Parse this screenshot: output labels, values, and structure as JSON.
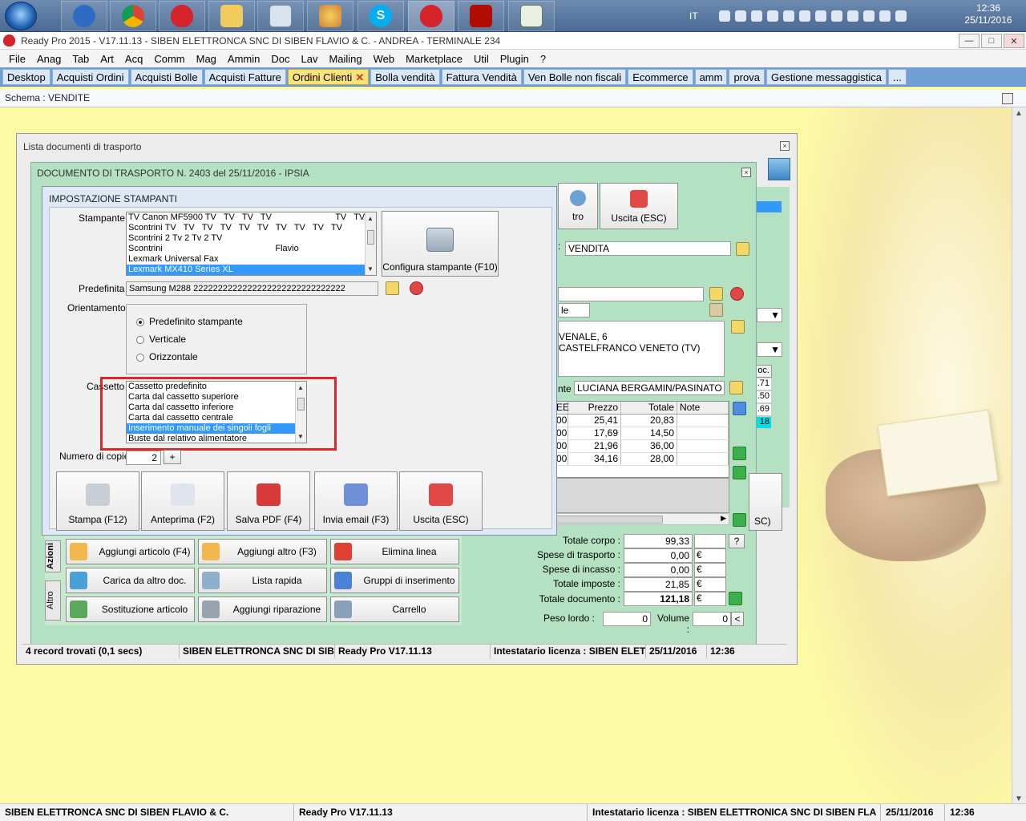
{
  "taskbar": {
    "language": "IT",
    "clock_time": "12:36",
    "clock_date": "25/11/2016"
  },
  "window": {
    "title": "Ready Pro 2015 - V17.11.13 - SIBEN ELETTRONCA SNC DI SIBEN FLAVIO & C. - ANDREA - TERMINALE 234",
    "min_label": "—",
    "max_label": "□",
    "close_label": "✕"
  },
  "menu": {
    "items": [
      "File",
      "Anag",
      "Tab",
      "Art",
      "Acq",
      "Comm",
      "Mag",
      "Ammin",
      "Doc",
      "Lav",
      "Mailing",
      "Web",
      "Marketplace",
      "Util",
      "Plugin",
      "?"
    ]
  },
  "tabs": {
    "items": [
      "Desktop",
      "Acquisti Ordini",
      "Acquisti Bolle",
      "Acquisti Fatture",
      "Ordini Clienti",
      "Bolla vendità",
      "Fattura Vendità",
      "Ven Bolle non fiscali",
      "Ecommerce",
      "amm",
      "prova",
      "Gestione messaggistica",
      "..."
    ],
    "active_index": 4,
    "close_glyph": "✕"
  },
  "schema": {
    "label": "Schema : VENDITE"
  },
  "lista": {
    "title": "Lista documenti di trasporto",
    "status_records": "4 record trovati (0,1 secs)",
    "status_company": "SIBEN ELETTRONCA SNC DI SIBEN F",
    "status_version": "Ready Pro V17.11.13",
    "status_license": "Intestatario licenza : SIBEN ELETT",
    "status_date": "25/11/2016",
    "status_time": "12:36",
    "side_values": [
      ".71",
      ".50",
      ".69",
      "18"
    ],
    "side_header": "oc."
  },
  "documento": {
    "title": "DOCUMENTO DI TRASPORTO N. 2403 del 25/11/2016 - IPSIA",
    "partial_btn_label": "tro",
    "exit_label": "Uscita (ESC)",
    "causale_value": "VENDITA",
    "field_le": "le",
    "address_line1": "VENALE, 6",
    "address_line2": "CASTELFRANCO VENETO  (TV)",
    "field_nte": "nte",
    "contact_value": "LUCIANA BERGAMIN/PASINATO",
    "table_headers": [
      "EE",
      "Prezzo",
      "Totale",
      "Note"
    ],
    "table_rows": [
      {
        "q": "00",
        "prezzo": "25,41",
        "totale": "20,83"
      },
      {
        "q": "00",
        "prezzo": "17,69",
        "totale": "14,50"
      },
      {
        "q": "00",
        "prezzo": "21,96",
        "totale": "36,00"
      },
      {
        "q": "00",
        "prezzo": "34,16",
        "totale": "28,00"
      }
    ],
    "totals": {
      "corpo_label": "Totale corpo :",
      "corpo_value": "99,33",
      "trasporto_label": "Spese di trasporto :",
      "trasporto_value": "0,00",
      "incasso_label": "Spese di incasso :",
      "incasso_value": "0,00",
      "imposte_label": "Totale imposte :",
      "imposte_value": "21,85",
      "documento_label": "Totale documento :",
      "documento_value": "121,18",
      "currency": "€",
      "help": "?"
    },
    "peso_label": "Peso lordo :",
    "peso_value": "0",
    "volume_label": "Volume :",
    "volume_value": "0",
    "lt": "<",
    "partial_sc": "SC)",
    "side_tabs": [
      "Azioni",
      "Altro"
    ],
    "actions": [
      "Aggiungi articolo (F4)",
      "Aggiungi altro (F3)",
      "Elimina linea",
      "Carica da altro doc.",
      "Lista rapida",
      "Gruppi di inserimento",
      "Sostituzione articolo",
      "Aggiungi riparazione",
      "Carrello"
    ]
  },
  "dialog": {
    "title": "IMPOSTAZIONE STAMPANTI",
    "printers_label": "Stampante",
    "printers": [
      "TV Canon MF5900 TV   TV   TV   TV                          TV   TV   TV   TV",
      "Scontrini TV   TV   TV   TV   TV   TV   TV   TV   TV   TV",
      "Scontrini 2 Tv 2 Tv 2 TV",
      "Scontrini                                              Flavio",
      "Lexmark Universal Fax",
      "Lexmark MX410 Series XL"
    ],
    "printer_selected": 5,
    "config_btn": "Configura stampante (F10)",
    "default_label": "Predefinita",
    "default_value": "Samsung M288 2222222222222222222222222222222",
    "orient_label": "Orientamento",
    "orient_options": [
      "Predefinito stampante",
      "Verticale",
      "Orizzontale"
    ],
    "orient_selected": 0,
    "tray_label": "Cassetto",
    "trays": [
      "Cassetto predefinito",
      "Carta dal cassetto superiore",
      "Carta dal cassetto inferiore",
      "Carta dal cassetto centrale",
      "Inserimento manuale dei singoli fogli",
      "Buste dal relativo alimentatore"
    ],
    "tray_selected": 4,
    "copies_label": "Numero di copie",
    "copies_value": "2",
    "copies_plus": "+",
    "buttons": [
      "Stampa (F12)",
      "Anteprima (F2)",
      "Salva PDF (F4)",
      "Invia email (F3)",
      "Uscita (ESC)"
    ]
  },
  "bottom_status": {
    "company": "SIBEN ELETTRONCA SNC DI SIBEN FLAVIO & C.",
    "version": "Ready Pro V17.11.13",
    "license": "Intestatario licenza : SIBEN ELETTRONICA SNC DI SIBEN FLA",
    "date": "25/11/2016",
    "time": "12:36"
  }
}
